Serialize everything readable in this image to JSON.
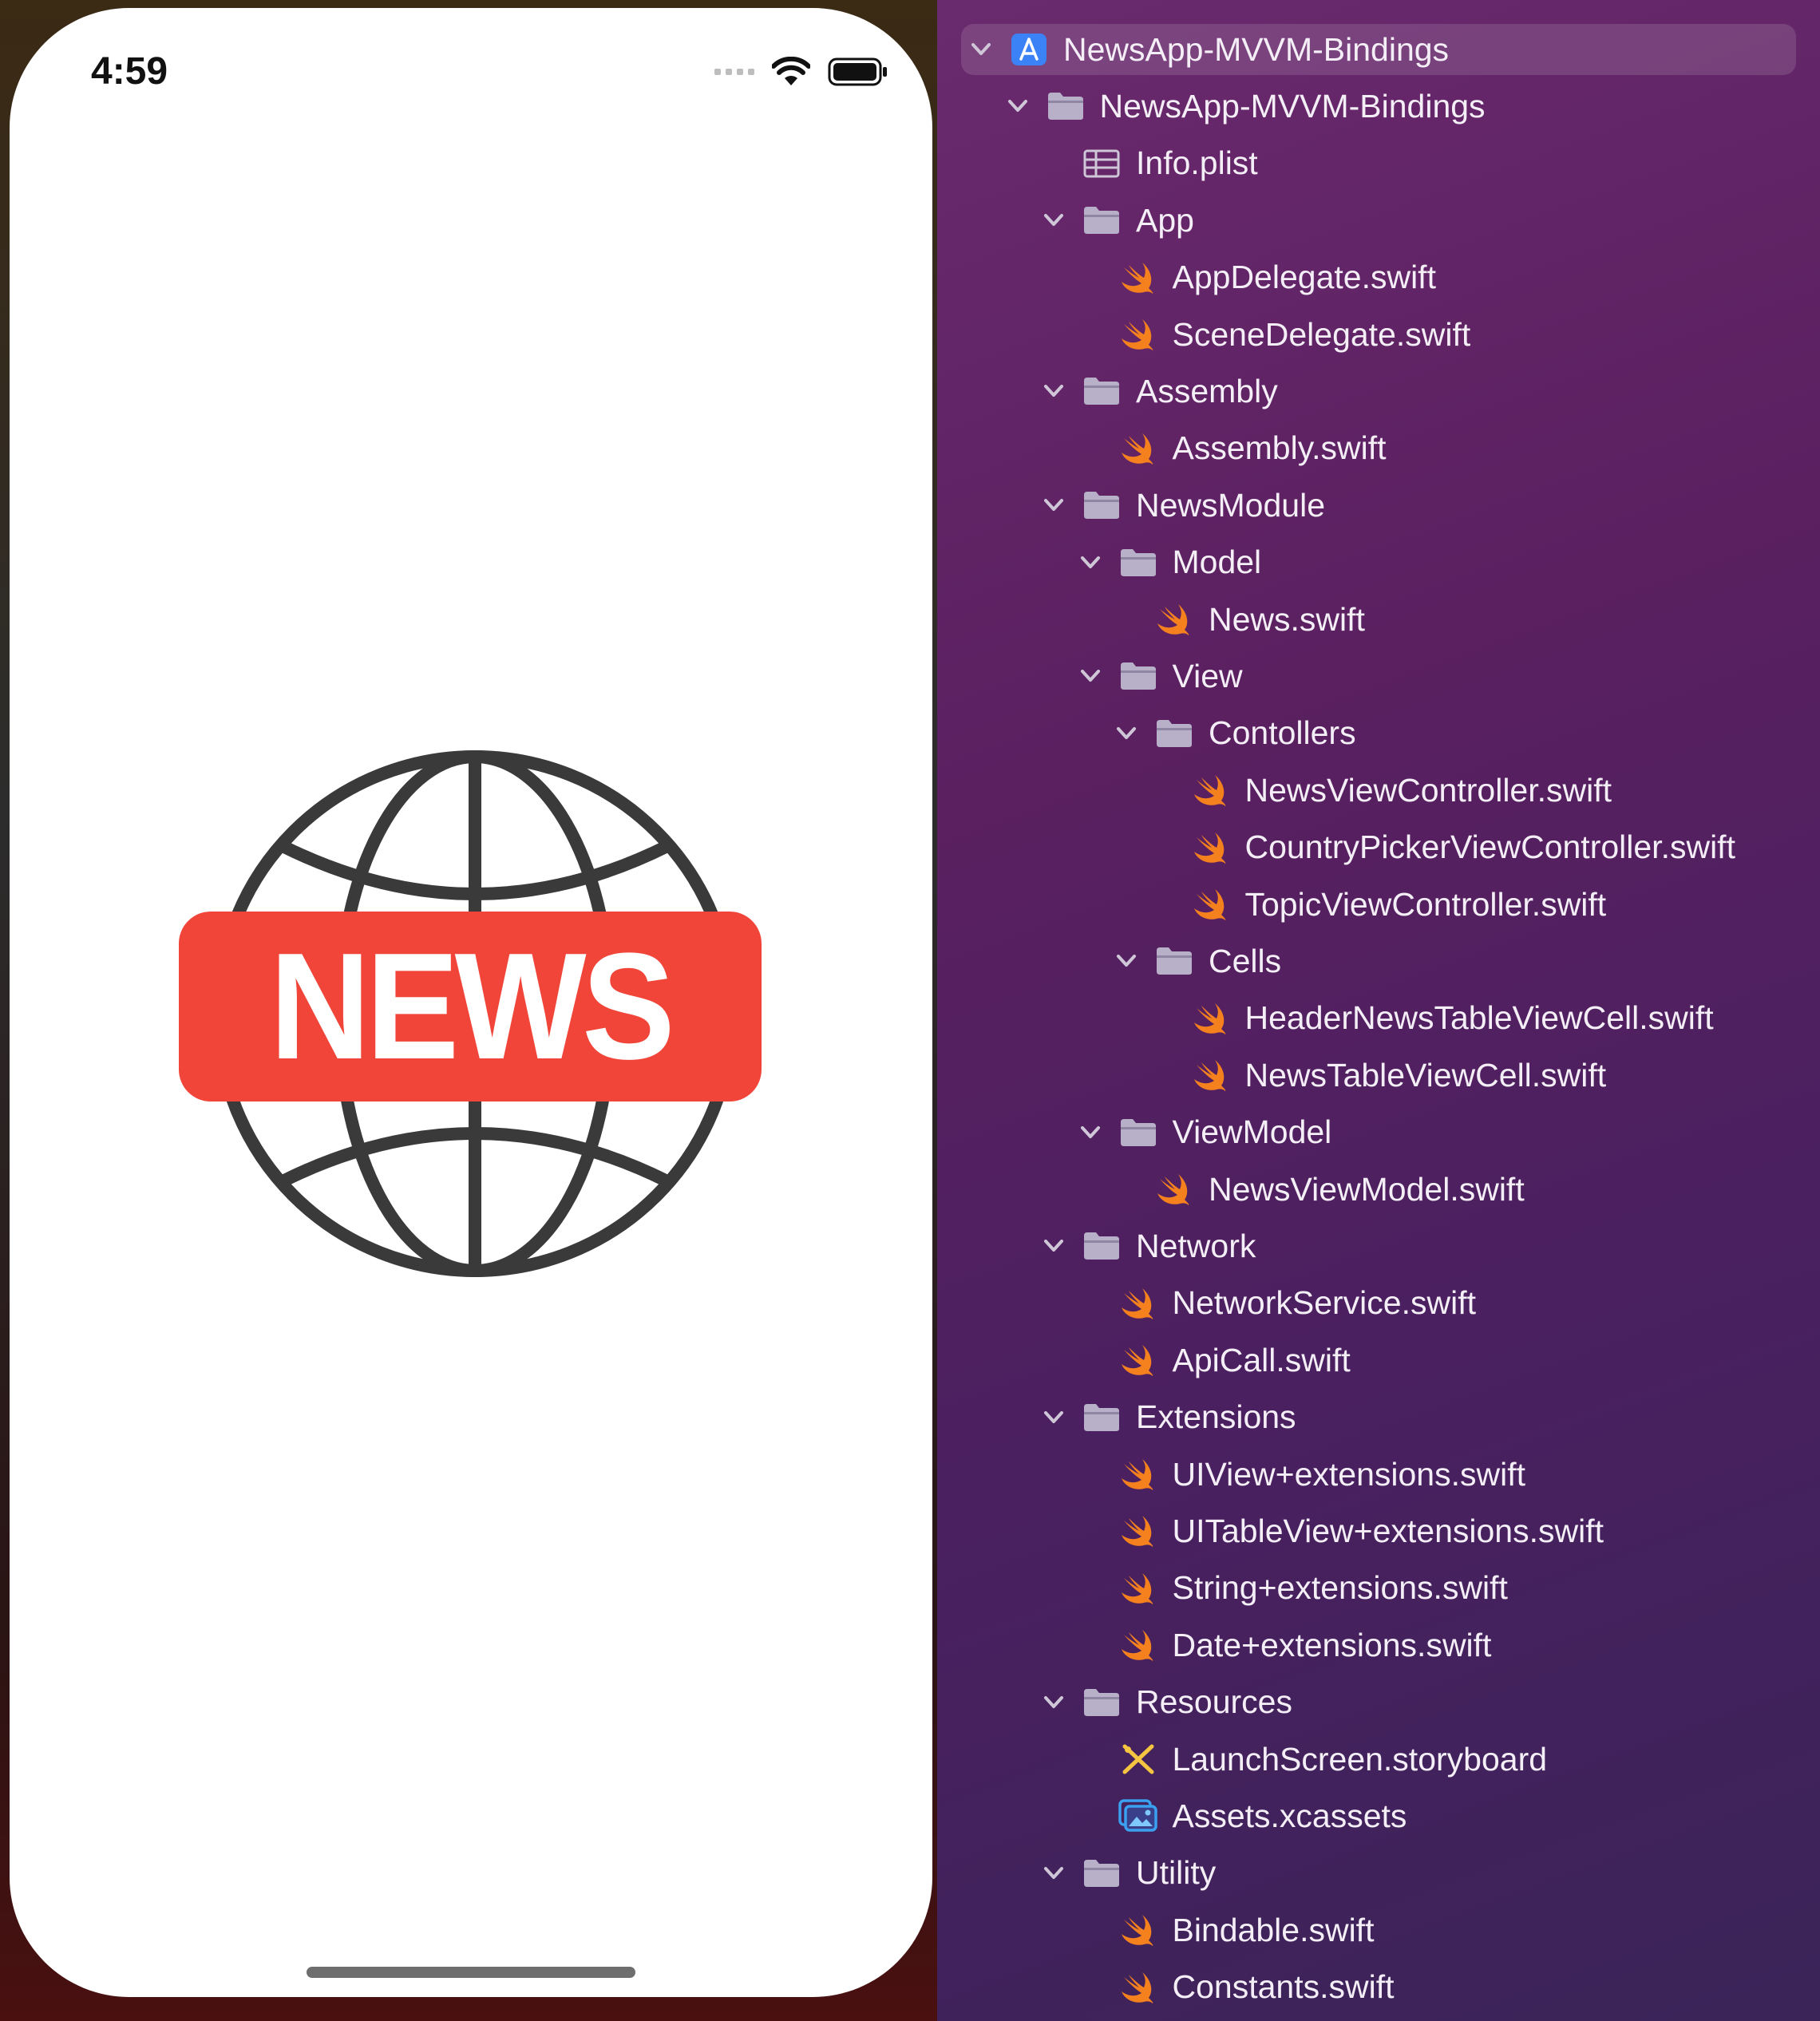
{
  "phone": {
    "status_time": "4:59",
    "logo_text": "NEWS",
    "colors": {
      "banner": "#f2453a",
      "globe": "#3a3a3a"
    }
  },
  "navigator": {
    "items": [
      {
        "label": "NewsApp-MVVM-Bindings",
        "type": "project",
        "level": 0,
        "expanded": true,
        "selected": true
      },
      {
        "label": "NewsApp-MVVM-Bindings",
        "type": "folder",
        "level": 1,
        "expanded": true
      },
      {
        "label": "Info.plist",
        "type": "plist",
        "level": 2
      },
      {
        "label": "App",
        "type": "folder",
        "level": 2,
        "expanded": true
      },
      {
        "label": "AppDelegate.swift",
        "type": "swift",
        "level": 3
      },
      {
        "label": "SceneDelegate.swift",
        "type": "swift",
        "level": 3
      },
      {
        "label": "Assembly",
        "type": "folder",
        "level": 2,
        "expanded": true
      },
      {
        "label": "Assembly.swift",
        "type": "swift",
        "level": 3
      },
      {
        "label": "NewsModule",
        "type": "folder",
        "level": 2,
        "expanded": true
      },
      {
        "label": "Model",
        "type": "folder",
        "level": 3,
        "expanded": true
      },
      {
        "label": "News.swift",
        "type": "swift",
        "level": 4
      },
      {
        "label": "View",
        "type": "folder",
        "level": 3,
        "expanded": true
      },
      {
        "label": "Contollers",
        "type": "folder",
        "level": 4,
        "expanded": true
      },
      {
        "label": "NewsViewController.swift",
        "type": "swift",
        "level": 5
      },
      {
        "label": "CountryPickerViewController.swift",
        "type": "swift",
        "level": 5
      },
      {
        "label": "TopicViewController.swift",
        "type": "swift",
        "level": 5
      },
      {
        "label": "Cells",
        "type": "folder",
        "level": 4,
        "expanded": true
      },
      {
        "label": "HeaderNewsTableViewCell.swift",
        "type": "swift",
        "level": 5
      },
      {
        "label": "NewsTableViewCell.swift",
        "type": "swift",
        "level": 5
      },
      {
        "label": "ViewModel",
        "type": "folder",
        "level": 3,
        "expanded": true
      },
      {
        "label": "NewsViewModel.swift",
        "type": "swift",
        "level": 4
      },
      {
        "label": "Network",
        "type": "folder",
        "level": 2,
        "expanded": true
      },
      {
        "label": "NetworkService.swift",
        "type": "swift",
        "level": 3
      },
      {
        "label": "ApiCall.swift",
        "type": "swift",
        "level": 3
      },
      {
        "label": "Extensions",
        "type": "folder",
        "level": 2,
        "expanded": true
      },
      {
        "label": "UIView+extensions.swift",
        "type": "swift",
        "level": 3
      },
      {
        "label": "UITableView+extensions.swift",
        "type": "swift",
        "level": 3
      },
      {
        "label": "String+extensions.swift",
        "type": "swift",
        "level": 3
      },
      {
        "label": "Date+extensions.swift",
        "type": "swift",
        "level": 3
      },
      {
        "label": "Resources",
        "type": "folder",
        "level": 2,
        "expanded": true
      },
      {
        "label": "LaunchScreen.storyboard",
        "type": "storyboard",
        "level": 3
      },
      {
        "label": "Assets.xcassets",
        "type": "assets",
        "level": 3
      },
      {
        "label": "Utility",
        "type": "folder",
        "level": 2,
        "expanded": true
      },
      {
        "label": "Bindable.swift",
        "type": "swift",
        "level": 3
      },
      {
        "label": "Constants.swift",
        "type": "swift",
        "level": 3
      }
    ],
    "colors": {
      "text": "#f4eef6",
      "folder": "#b8b0c8",
      "swift": "#f4801e",
      "project": "#3b82f6"
    }
  }
}
